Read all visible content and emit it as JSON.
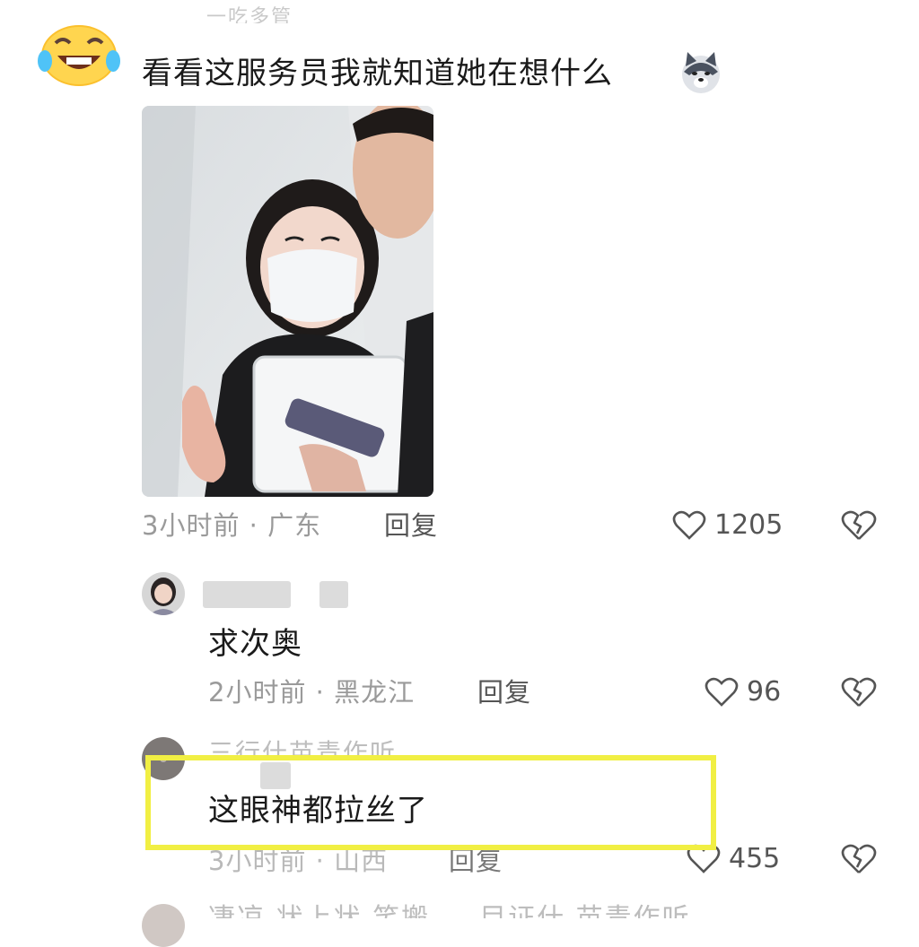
{
  "top_cut_text": "一吃多管",
  "comment_main": {
    "text": "看看这服务员我就知道她在想什么",
    "emoji_icon": "husky-dog-emoji-icon",
    "avatar_icon": "laughing-tears-emoji-icon",
    "meta": "3小时前 · 广东",
    "reply_label": "回复",
    "likes": "1205"
  },
  "reply_1": {
    "text": "求次奥",
    "meta": "2小时前 · 黑龙江",
    "reply_label": "回复",
    "likes": "96"
  },
  "reply_2": {
    "name_faded": "三行什苗青作听",
    "text": "这眼神都拉丝了",
    "meta": "3小时前 · 山西",
    "reply_label": "回复",
    "likes": "455"
  },
  "bottom_cut_text": "凄凉  状上状 笑搬 … 目证什 苗青作听",
  "colors": {
    "highlight": "#f1ef43",
    "meta": "#9a9a9a",
    "text": "#1a1a1a"
  }
}
